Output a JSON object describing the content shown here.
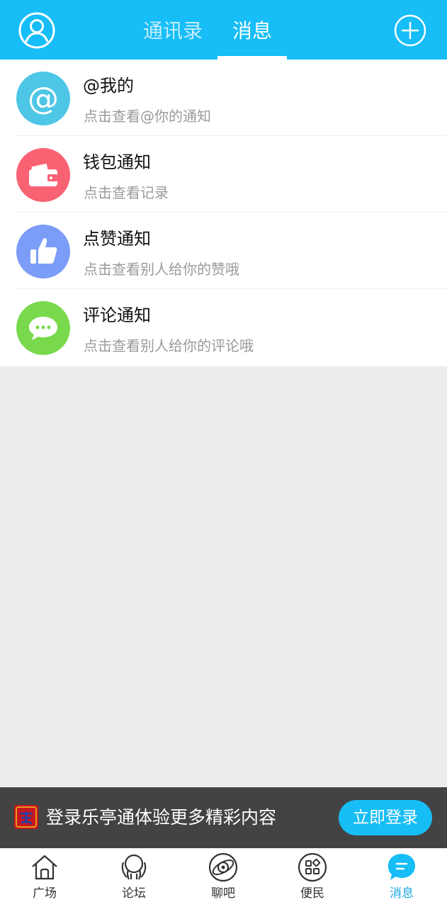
{
  "header": {
    "tabs": [
      {
        "label": "通讯录",
        "active": false
      },
      {
        "label": "消息",
        "active": true
      }
    ],
    "left_icon": "user-avatar-icon",
    "right_icon": "plus-circle-icon",
    "background_color": "#16bdf7"
  },
  "notifications": [
    {
      "title": "@我的",
      "subtitle": "点击查看@你的通知",
      "icon": "at-icon",
      "icon_color": "#4ec6e6"
    },
    {
      "title": "钱包通知",
      "subtitle": "点击查看记录",
      "icon": "wallet-icon",
      "icon_color": "#f96272"
    },
    {
      "title": "点赞通知",
      "subtitle": "点击查看别人给你的赞哦",
      "icon": "thumbs-up-icon",
      "icon_color": "#7b9df8"
    },
    {
      "title": "评论通知",
      "subtitle": "点击查看别人给你的评论哦",
      "icon": "comment-icon",
      "icon_color": "#79d94c"
    }
  ],
  "login_banner": {
    "text": "登录乐亭通体验更多精彩内容",
    "button_label": "立即登录",
    "logo_icon": "app-logo-icon"
  },
  "bottom_nav": [
    {
      "label": "广场",
      "icon": "home-icon",
      "active": false
    },
    {
      "label": "论坛",
      "icon": "forum-icon",
      "active": false
    },
    {
      "label": "聊吧",
      "icon": "chat-planet-icon",
      "active": false
    },
    {
      "label": "便民",
      "icon": "services-grid-icon",
      "active": false
    },
    {
      "label": "消息",
      "icon": "message-bubble-icon",
      "active": true
    }
  ],
  "colors": {
    "accent": "#16bdf7",
    "active_nav": "#1aa8e0",
    "banner_bg": "#434343"
  }
}
